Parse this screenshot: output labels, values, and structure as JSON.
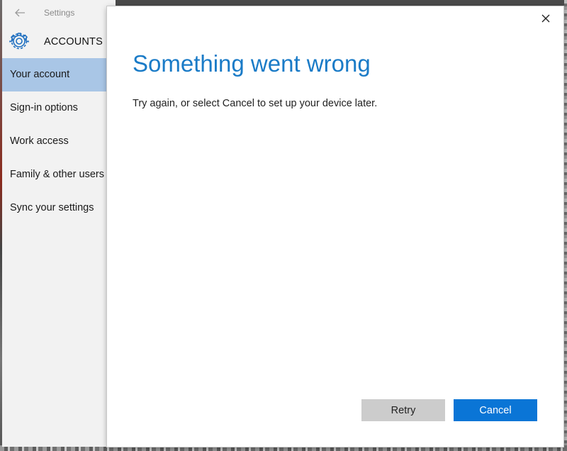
{
  "settings_window": {
    "title": "Settings",
    "back_icon": "back-arrow-icon",
    "section_icon": "gear-icon",
    "section_title": "ACCOUNTS",
    "nav_items": [
      {
        "label": "Your account",
        "selected": true
      },
      {
        "label": "Sign-in options",
        "selected": false
      },
      {
        "label": "Work access",
        "selected": false
      },
      {
        "label": "Family & other users",
        "selected": false
      },
      {
        "label": "Sync your settings",
        "selected": false
      }
    ]
  },
  "dialog": {
    "close_icon": "close-icon",
    "title": "Something went wrong",
    "message": "Try again, or select Cancel to set up your device later.",
    "retry_label": "Retry",
    "cancel_label": "Cancel"
  },
  "colors": {
    "accent": "#0a75d6",
    "title_blue": "#1a7bc7",
    "nav_selected": "#a9c6e6"
  }
}
